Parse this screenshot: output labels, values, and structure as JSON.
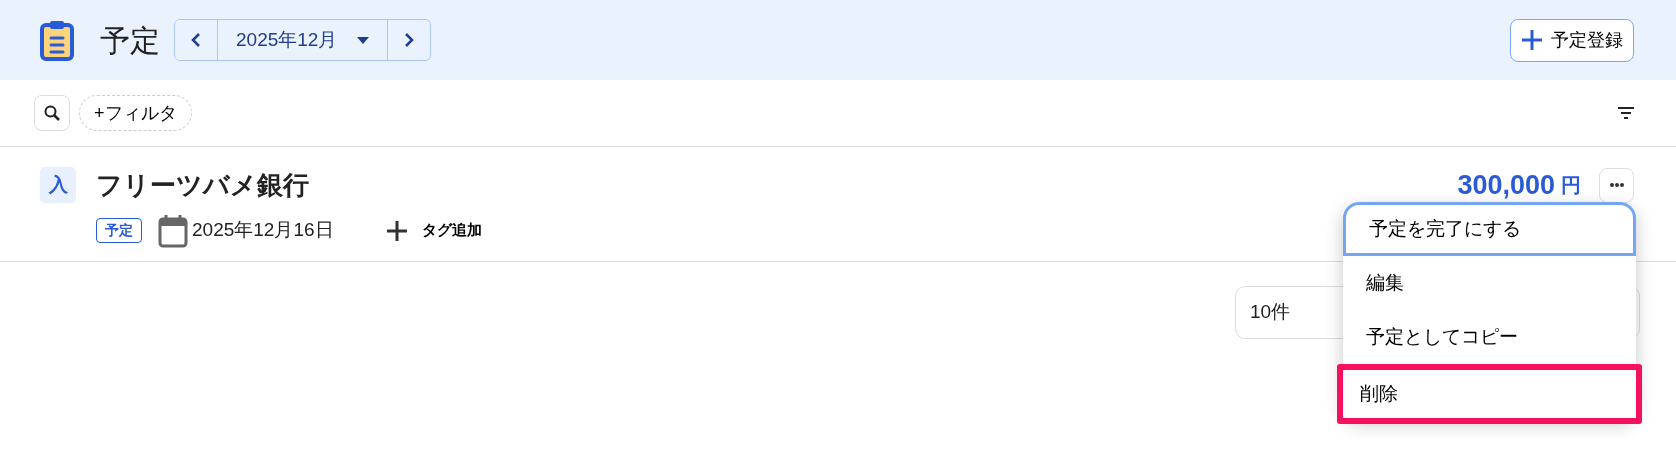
{
  "header": {
    "title": "予定",
    "month": "2025年12月",
    "register_button": "予定登録"
  },
  "filter_bar": {
    "filter_chip": "+フィルタ"
  },
  "entries": [
    {
      "type_badge": "入",
      "name": "フリーツバメ銀行",
      "status": "予定",
      "date": "2025年12月16日",
      "add_tag": "タグ追加",
      "amount": "300,000",
      "currency": "円"
    }
  ],
  "page_size": {
    "value": "10件"
  },
  "menu": {
    "items": [
      {
        "label": "予定を完了にする",
        "focused": true,
        "highlighted": false
      },
      {
        "label": "編集",
        "focused": false,
        "highlighted": false
      },
      {
        "label": "予定としてコピー",
        "focused": false,
        "highlighted": false
      },
      {
        "label": "削除",
        "focused": false,
        "highlighted": true
      }
    ]
  }
}
